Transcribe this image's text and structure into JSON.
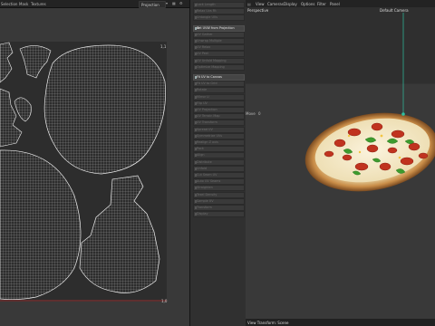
{
  "uv_editor": {
    "menu": [
      "Selection",
      "Mask",
      "Textures"
    ],
    "projection_select": "Projection",
    "corner_top": "1,1",
    "corner_bottom": "1,0"
  },
  "tool_panel": {
    "items": [
      {
        "label": "Lock Length",
        "active": false
      },
      {
        "label": "Relax Uvs Fit",
        "active": false
      },
      {
        "label": "Untangle UVs",
        "active": false
      },
      {
        "label": "Set UVW from Projection",
        "active": true,
        "gear": true
      },
      {
        "label": "UV Gather",
        "active": false
      },
      {
        "label": "Unwrap Multiple",
        "active": false
      },
      {
        "label": "UV Relax",
        "active": false
      },
      {
        "label": "UV Peel",
        "active": false
      },
      {
        "label": "UV Unfold Mapping",
        "active": false
      },
      {
        "label": "Optimize Mapping",
        "active": false
      },
      {
        "label": "Fit UV to Canvas",
        "active": true,
        "gear": false
      },
      {
        "label": "Fit UV to Grid",
        "active": false
      },
      {
        "label": "Rotate",
        "active": false
      },
      {
        "label": "Mirror U",
        "active": false
      },
      {
        "label": "Flip UV",
        "active": false
      },
      {
        "label": "UV Projection",
        "active": false
      },
      {
        "label": "UV Terrain Map",
        "active": false
      },
      {
        "label": "UV Transform",
        "active": false
      },
      {
        "label": "Spread UV",
        "active": false
      },
      {
        "label": "Symmetrize UVs",
        "active": false
      },
      {
        "label": "Realign Z axis",
        "active": false
      },
      {
        "label": "Pack",
        "active": false
      },
      {
        "label": "Align",
        "active": false
      },
      {
        "label": "Distribute",
        "active": false
      },
      {
        "label": "Unfold",
        "active": false
      },
      {
        "label": "Cut Seam UV",
        "active": false
      },
      {
        "label": "Auto UV Seams",
        "active": false
      },
      {
        "label": "Straighten",
        "active": false
      },
      {
        "label": "Texel Density",
        "active": false
      },
      {
        "label": "Sample UV",
        "active": false
      },
      {
        "label": "Transform",
        "active": false
      },
      {
        "label": "Display",
        "active": false
      }
    ]
  },
  "viewport": {
    "menu": [
      "View",
      "Cameras",
      "Display",
      "Options",
      "Filter",
      "Panel"
    ],
    "view_label": "Perspective",
    "camera_label": "Default Camera",
    "side_label": "Move",
    "side_value": "0",
    "status": "View Transform: Scene"
  },
  "colors": {
    "accent_active": "#e6e6e6",
    "uv_wire": "#e8e8e8",
    "camera_line": "#2fbfa0",
    "bound_line": "#b33333"
  }
}
